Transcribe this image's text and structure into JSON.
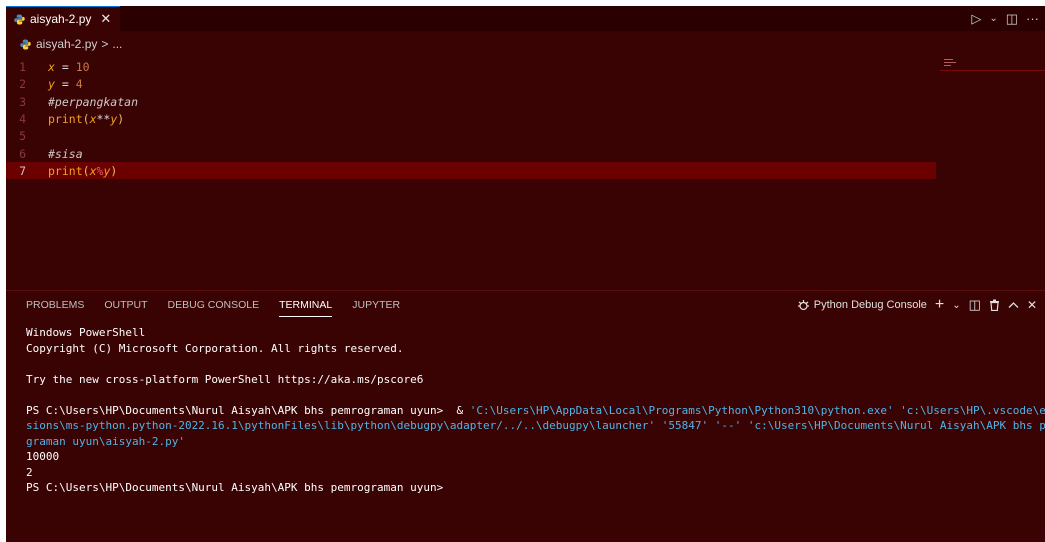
{
  "tab": {
    "filename": "aisyah-2.py",
    "close": "✕"
  },
  "tab_actions": {
    "run": "▷",
    "run_dropdown": "⌄",
    "split": "◫",
    "more": "···"
  },
  "breadcrumb": {
    "file": "aisyah-2.py",
    "separator": ">",
    "more": "..."
  },
  "editor": {
    "lines": [
      {
        "n": "1"
      },
      {
        "n": "2"
      },
      {
        "n": "3"
      },
      {
        "n": "4"
      },
      {
        "n": "5"
      },
      {
        "n": "6"
      },
      {
        "n": "7"
      }
    ],
    "code": {
      "l1": {
        "var": "x",
        "op": " = ",
        "num": "10"
      },
      "l2": {
        "var": "y",
        "op": " = ",
        "num": "4"
      },
      "l3": {
        "comment": "#perpangkatan"
      },
      "l4": {
        "fn": "print",
        "open": "(",
        "a": "x",
        "op": "**",
        "b": "y",
        "close": ")"
      },
      "l6": {
        "comment": "#sisa"
      },
      "l7": {
        "fn": "print",
        "open": "(",
        "a": "x",
        "op": "%",
        "b": "y",
        "close": ")"
      }
    }
  },
  "panel": {
    "tabs": [
      "PROBLEMS",
      "OUTPUT",
      "DEBUG CONSOLE",
      "TERMINAL",
      "JUPYTER"
    ],
    "active_tab": "TERMINAL",
    "terminal_name": "Python Debug Console",
    "actions": {
      "add": "+",
      "add_dropdown": "⌄",
      "split": "◫",
      "trash": "🗑",
      "maximize": "^",
      "close": "✕"
    }
  },
  "terminal": {
    "l1": "Windows PowerShell",
    "l2": "Copyright (C) Microsoft Corporation. All rights reserved.",
    "l3": "Try the new cross-platform PowerShell https://aka.ms/pscore6",
    "prompt": "PS C:\\Users\\HP\\Documents\\Nurul Aisyah\\APK bhs pemrograman uyun>  & ",
    "cmd1": "'C:\\Users\\HP\\AppData\\Local\\Programs\\Python\\Python310\\python.exe' 'c:\\Users\\HP\\.vscode\\exten",
    "cmd2": "sions\\ms-python.python-2022.16.1\\pythonFiles\\lib\\python\\debugpy\\adapter/../..\\debugpy\\launcher' '55847' '--' 'c:\\Users\\HP\\Documents\\Nurul Aisyah\\APK bhs pemro",
    "cmd3": "graman uyun\\aisyah-2.py'",
    "out1": "10000",
    "out2": "2",
    "final_prompt": "PS C:\\Users\\HP\\Documents\\Nurul Aisyah\\APK bhs pemrograman uyun>"
  },
  "colors": {
    "background": "#3a0303",
    "active_line": "#6b0000",
    "accent": "#0078d4",
    "variable": "#f0a020",
    "path_string": "#4fb3e8"
  }
}
